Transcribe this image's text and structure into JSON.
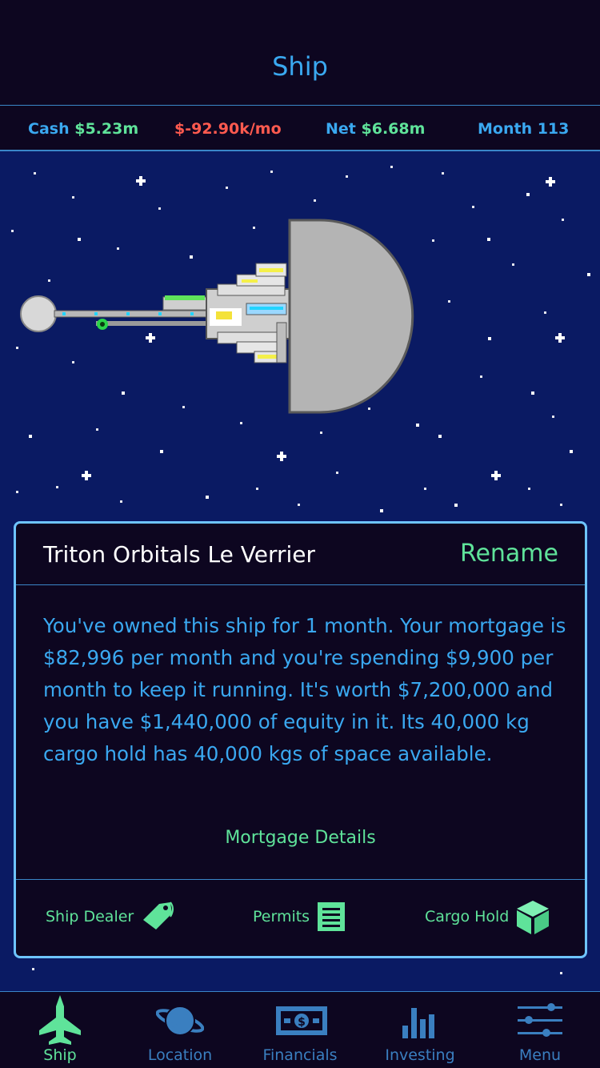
{
  "header": {
    "title": "Ship"
  },
  "stats": {
    "cash_label": "Cash",
    "cash_value": "$5.23m",
    "burn": "$-92.90k/mo",
    "net_label": "Net",
    "net_value": "$6.68m",
    "month": "Month 113"
  },
  "panel": {
    "ship_name": "Triton Orbitals Le Verrier",
    "rename_label": "Rename",
    "description": "You've owned this ship for 1 month. Your mortgage is $82,996 per month and you're spending $9,900 per month to keep it running. It's worth $7,200,000 and you have $1,440,000 of equity in it. Its 40,000 kg cargo hold has 40,000 kgs of space available.",
    "mortgage_link": "Mortgage Details",
    "actions": [
      {
        "label": "Ship Dealer",
        "icon": "tag-icon"
      },
      {
        "label": "Permits",
        "icon": "document-icon"
      },
      {
        "label": "Cargo Hold",
        "icon": "cube-icon"
      }
    ]
  },
  "tabs": [
    {
      "label": "Ship",
      "icon": "jet-icon",
      "active": true
    },
    {
      "label": "Location",
      "icon": "planet-icon",
      "active": false
    },
    {
      "label": "Financials",
      "icon": "money-icon",
      "active": false
    },
    {
      "label": "Investing",
      "icon": "bar-chart-icon",
      "active": false
    },
    {
      "label": "Menu",
      "icon": "sliders-icon",
      "active": false
    }
  ],
  "colors": {
    "background": "#0d0620",
    "space": "#0a1a63",
    "accent_blue": "#3aa8f0",
    "accent_green": "#5fe39a",
    "negative": "#ff5a4f",
    "border": "#6ec4ff"
  }
}
